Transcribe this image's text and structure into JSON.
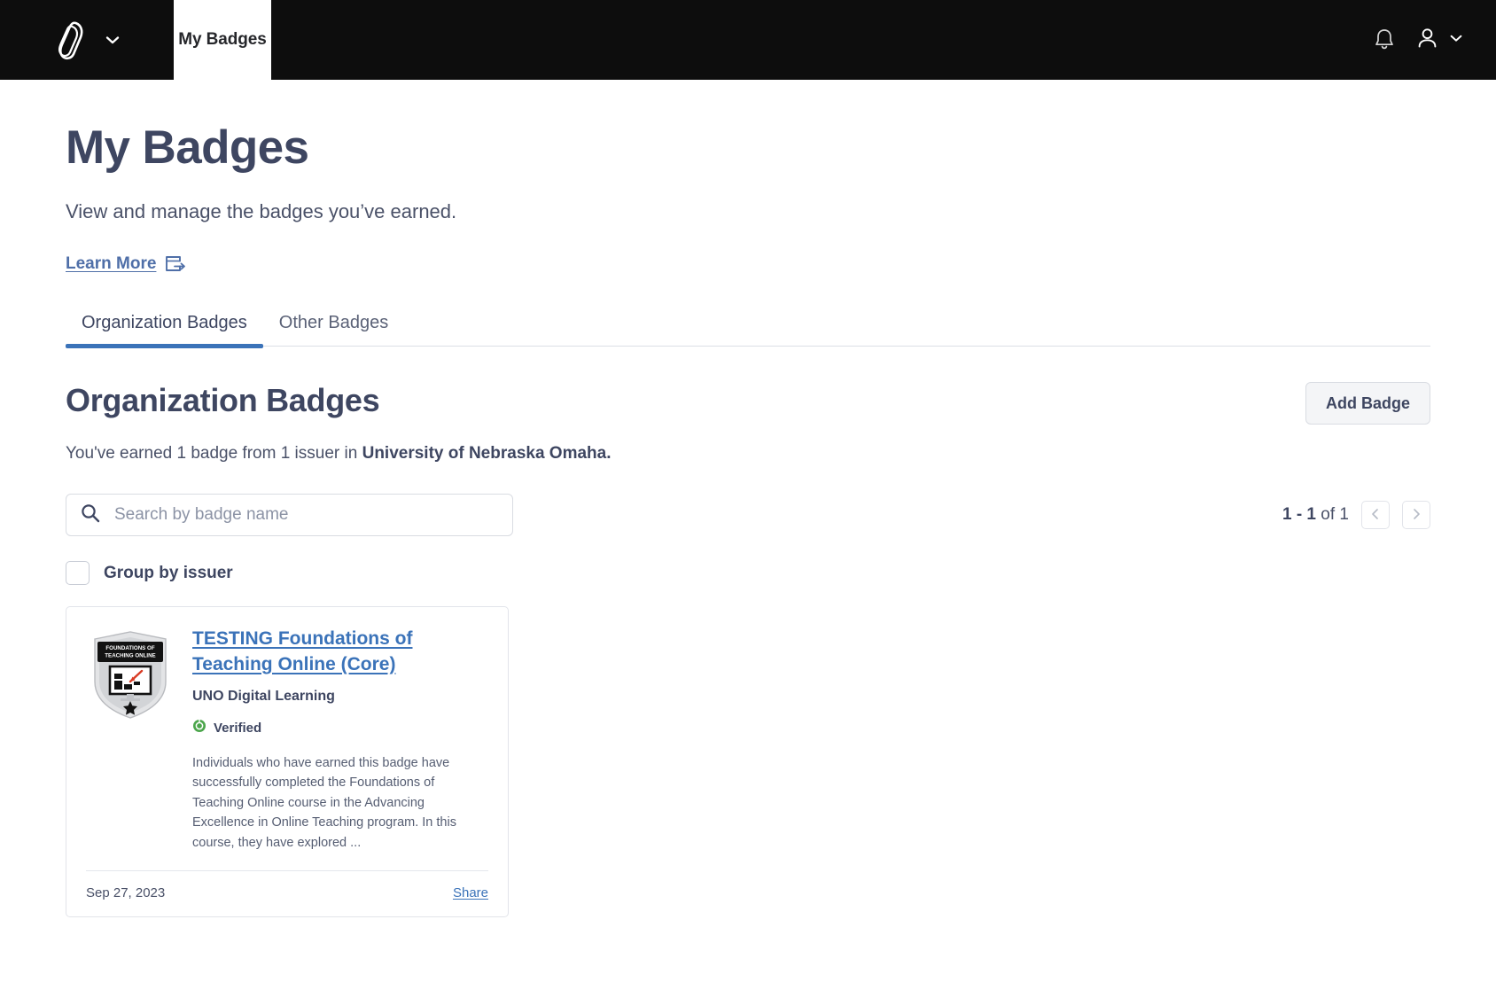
{
  "nav": {
    "brand_icon": "badgr-logo-icon",
    "brand_caret_icon": "chevron-down-icon",
    "active_tab": "My Badges",
    "notifications_icon": "bell-icon",
    "account_icon": "person-icon",
    "account_caret_icon": "chevron-down-icon"
  },
  "header": {
    "title": "My Badges",
    "subtitle": "View and manage the badges you’ve earned.",
    "learn_more_label": "Learn More",
    "learn_more_icon": "external-link-icon"
  },
  "tabs": [
    {
      "label": "Organization Badges",
      "active": true
    },
    {
      "label": "Other Badges",
      "active": false
    }
  ],
  "section": {
    "title": "Organization Badges",
    "add_badge_label": "Add Badge",
    "description_prefix": "You've earned 1 badge from 1 issuer in ",
    "description_org": "University of Nebraska Omaha."
  },
  "search": {
    "placeholder": "Search by badge name",
    "value": "",
    "icon": "search-icon"
  },
  "pagination": {
    "range": "1 - 1",
    "of_text": " of 1",
    "prev_icon": "chevron-left-icon",
    "next_icon": "chevron-right-icon"
  },
  "group_by": {
    "label": "Group by issuer",
    "checked": false
  },
  "badges": [
    {
      "image_alt": "Foundations of Teaching Online badge",
      "image_banner_line1": "FOUNDATIONS OF",
      "image_banner_line2": "TEACHING ONLINE",
      "name": "TESTING Foundations of Teaching Online (Core)",
      "issuer": "UNO Digital Learning",
      "verified_label": "Verified",
      "verified_icon": "verified-circle-icon",
      "description": "Individuals who have earned this badge have successfully completed the Foundations of Teaching Online course in the Advancing Excellence in Online Teaching program. In this course, they have explored ...",
      "date": "Sep 27, 2023",
      "share_label": "Share"
    }
  ],
  "colors": {
    "nav_background": "#0d0d0d",
    "heading": "#3e4661",
    "link": "#3b73b9",
    "tab_active_underline": "#3b73b9",
    "verified_green": "#4ca64c",
    "button_background": "#f4f5f7"
  }
}
